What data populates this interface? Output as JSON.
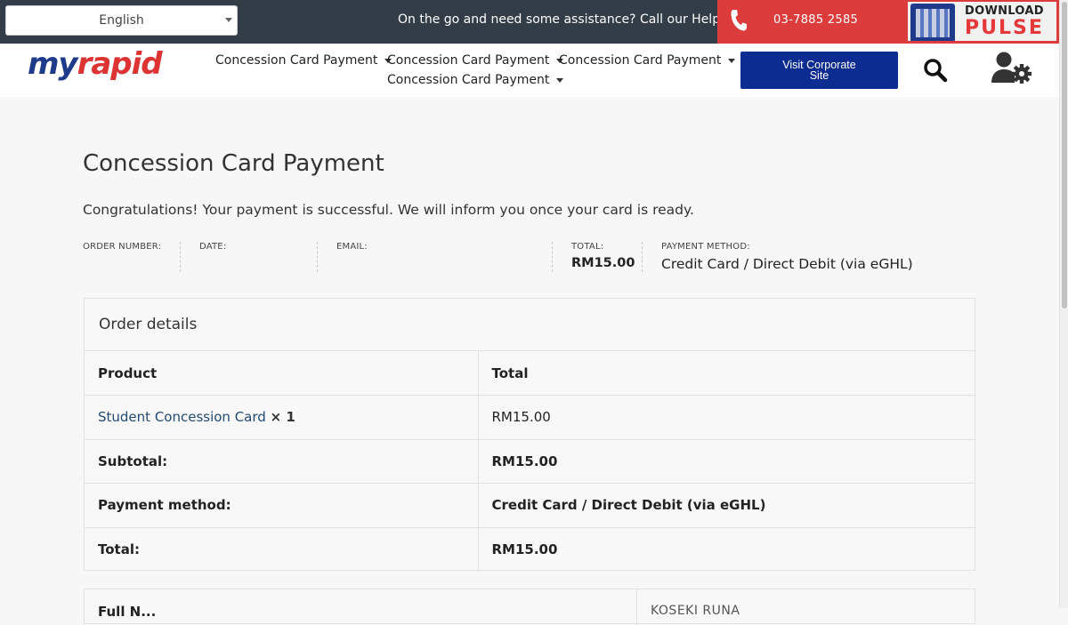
{
  "topbar": {
    "language": "English",
    "helpline_text": "On the go and need some assistance? Call our Helpline:",
    "phone_number": "03-7885 2585",
    "pulse_download": "DOWNLOAD",
    "pulse_word": "PULSE",
    "accent_color": "#dc3c3c",
    "bar_color": "#333d47"
  },
  "header": {
    "logo_my": "my",
    "logo_rapid": "rapid",
    "nav": [
      {
        "label": "Concession Card Payment"
      },
      {
        "label": "Concession Card Payment"
      },
      {
        "label": "Concession Card Payment"
      },
      {
        "label": "Concession Card Payment"
      }
    ],
    "corporate_button": "Visit Corporate Site",
    "corporate_button_color": "#0d2c91"
  },
  "main": {
    "title": "Concession Card Payment",
    "success_message": "Congratulations! Your payment is successful. We will inform you once your card is ready.",
    "overview": {
      "order_number_label": "ORDER NUMBER:",
      "date_label": "DATE:",
      "email_label": "EMAIL:",
      "total_label": "TOTAL:",
      "total_value": "RM15.00",
      "payment_method_label": "PAYMENT METHOD:",
      "payment_method_value": "Credit Card / Direct Debit (via eGHL)"
    },
    "order_details": {
      "heading": "Order details",
      "header_product": "Product",
      "header_total": "Total",
      "product_name": "Student Concession Card",
      "product_qty": "× 1",
      "product_total": "RM15.00",
      "subtotal_label": "Subtotal:",
      "subtotal_value": "RM15.00",
      "payment_method_label": "Payment method:",
      "payment_method_value": "Credit Card / Direct Debit (via eGHL)",
      "total_label": "Total:",
      "total_value": "RM15.00"
    },
    "customer": {
      "full_name_label": "Full N...",
      "full_name_value": "KOSEKI RUNA"
    }
  }
}
